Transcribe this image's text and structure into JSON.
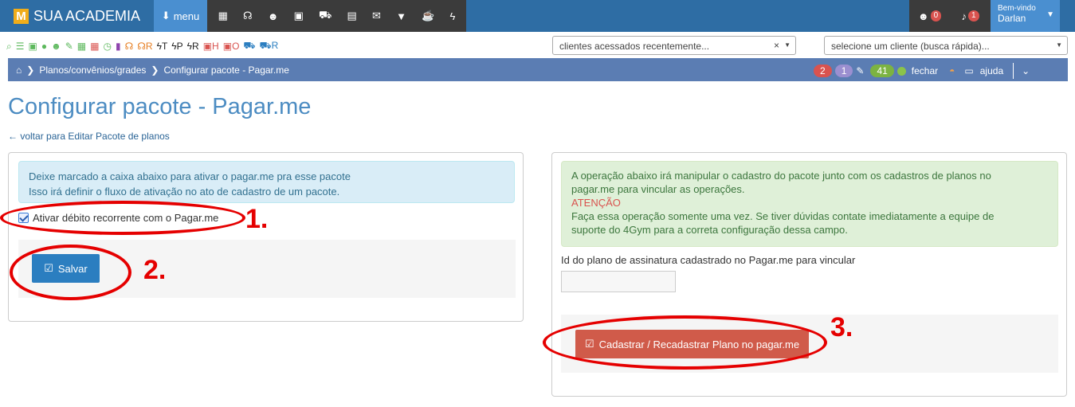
{
  "brand": {
    "logo": "M",
    "name": "SUA ACADEMIA"
  },
  "menu": {
    "label": "menu"
  },
  "top_icons": [
    "calendar-icon",
    "stethoscope-icon",
    "users-icon",
    "money-icon",
    "cart-icon",
    "file-icon",
    "envelope-icon",
    "filter-icon",
    "coffee-icon",
    "bolt-icon"
  ],
  "top_right": {
    "users_count": "0",
    "notifications_count": "1",
    "welcome": "Bem-vindo",
    "user": "Darlan"
  },
  "toolbar2": {
    "items": [
      "R",
      "T",
      "P",
      "R",
      "H",
      "O",
      "R"
    ]
  },
  "selects": {
    "recent": "clientes acessados recentemente...",
    "recent_clear": "×",
    "quick": "selecione um cliente (busca rápida)..."
  },
  "breadcrumb": {
    "level1": "Planos/convênios/grades",
    "level2": "Configurar pacote - Pagar.me",
    "pill1": "2",
    "pill2": "1",
    "pill3": "41",
    "fechar": "fechar",
    "ajuda": "ajuda"
  },
  "page": {
    "title": "Configurar pacote - Pagar.me",
    "back_link": "voltar para Editar Pacote de planos"
  },
  "left_panel": {
    "info_line1": "Deixe marcado a caixa abaixo para ativar o pagar.me pra esse pacote",
    "info_line2": "Isso irá definir o fluxo de ativação no ato de cadastro de um pacote.",
    "checkbox_label": "Ativar débito recorrente com o Pagar.me",
    "save_button": "Salvar"
  },
  "right_panel": {
    "line1": "A operação abaixo irá manipular o cadastro do pacote junto com os cadastros de planos no",
    "line2": "pagar.me para vincular as operações.",
    "warning": "ATENÇÃO",
    "line3": "Faça essa operação somente uma vez. Se tiver dúvidas contate imediatamente a equipe de",
    "line4": "suporte do 4Gym para a correta configuração dessa campo.",
    "field_label": "Id do plano de assinatura cadastrado no Pagar.me para vincular",
    "field_value": "",
    "submit_button": "Cadastrar / Recadastrar Plano no pagar.me"
  },
  "annotations": {
    "n1": "1.",
    "n2": "2.",
    "n3": "3."
  },
  "colors": {
    "topbar": "#2e6da4",
    "accent": "#4a8fd0",
    "annotation": "#e50000",
    "danger": "#d9534f",
    "primary": "#2b7ec0"
  }
}
